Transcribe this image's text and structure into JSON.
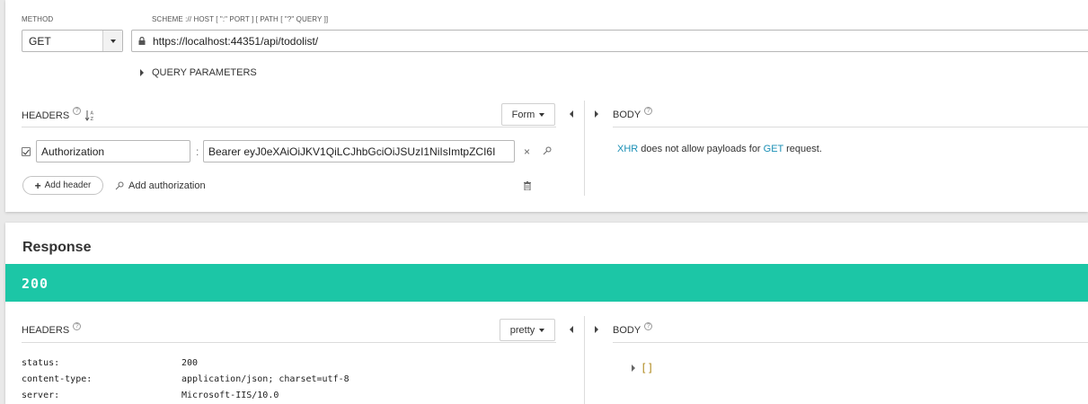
{
  "request": {
    "method_label": "METHOD",
    "method_value": "GET",
    "url_label": "SCHEME :// HOST [ \":\" PORT ] [ PATH [ \"?\" QUERY ]]",
    "url_value": "https://localhost:44351/api/todolist/",
    "query_parameters_label": "QUERY PARAMETERS",
    "headers_label": "HEADERS",
    "sort_icon_text": "↓",
    "form_button_label": "Form",
    "body_label": "BODY",
    "header_rows": [
      {
        "name": "Authorization",
        "value": "Bearer eyJ0eXAiOiJKV1QiLCJhbGciOiJSUzI1NiIsImtpZCI6I",
        "enabled": true
      }
    ],
    "add_header_label": "Add header",
    "add_authorization_label": "Add authorization",
    "body_message": {
      "xhr": "XHR",
      "middle": " does not allow payloads for ",
      "method": "GET",
      "end": " request."
    }
  },
  "response": {
    "title": "Response",
    "status_code": "200",
    "status_color": "#1cc6a6",
    "headers_label": "HEADERS",
    "pretty_button_label": "pretty",
    "body_label": "BODY",
    "headers": [
      {
        "key": "status:",
        "value": "200"
      },
      {
        "key": "content-type:",
        "value": "application/json; charset=utf-8"
      },
      {
        "key": "server:",
        "value": "Microsoft-IIS/10.0"
      }
    ],
    "body_json_preview": "[]"
  }
}
